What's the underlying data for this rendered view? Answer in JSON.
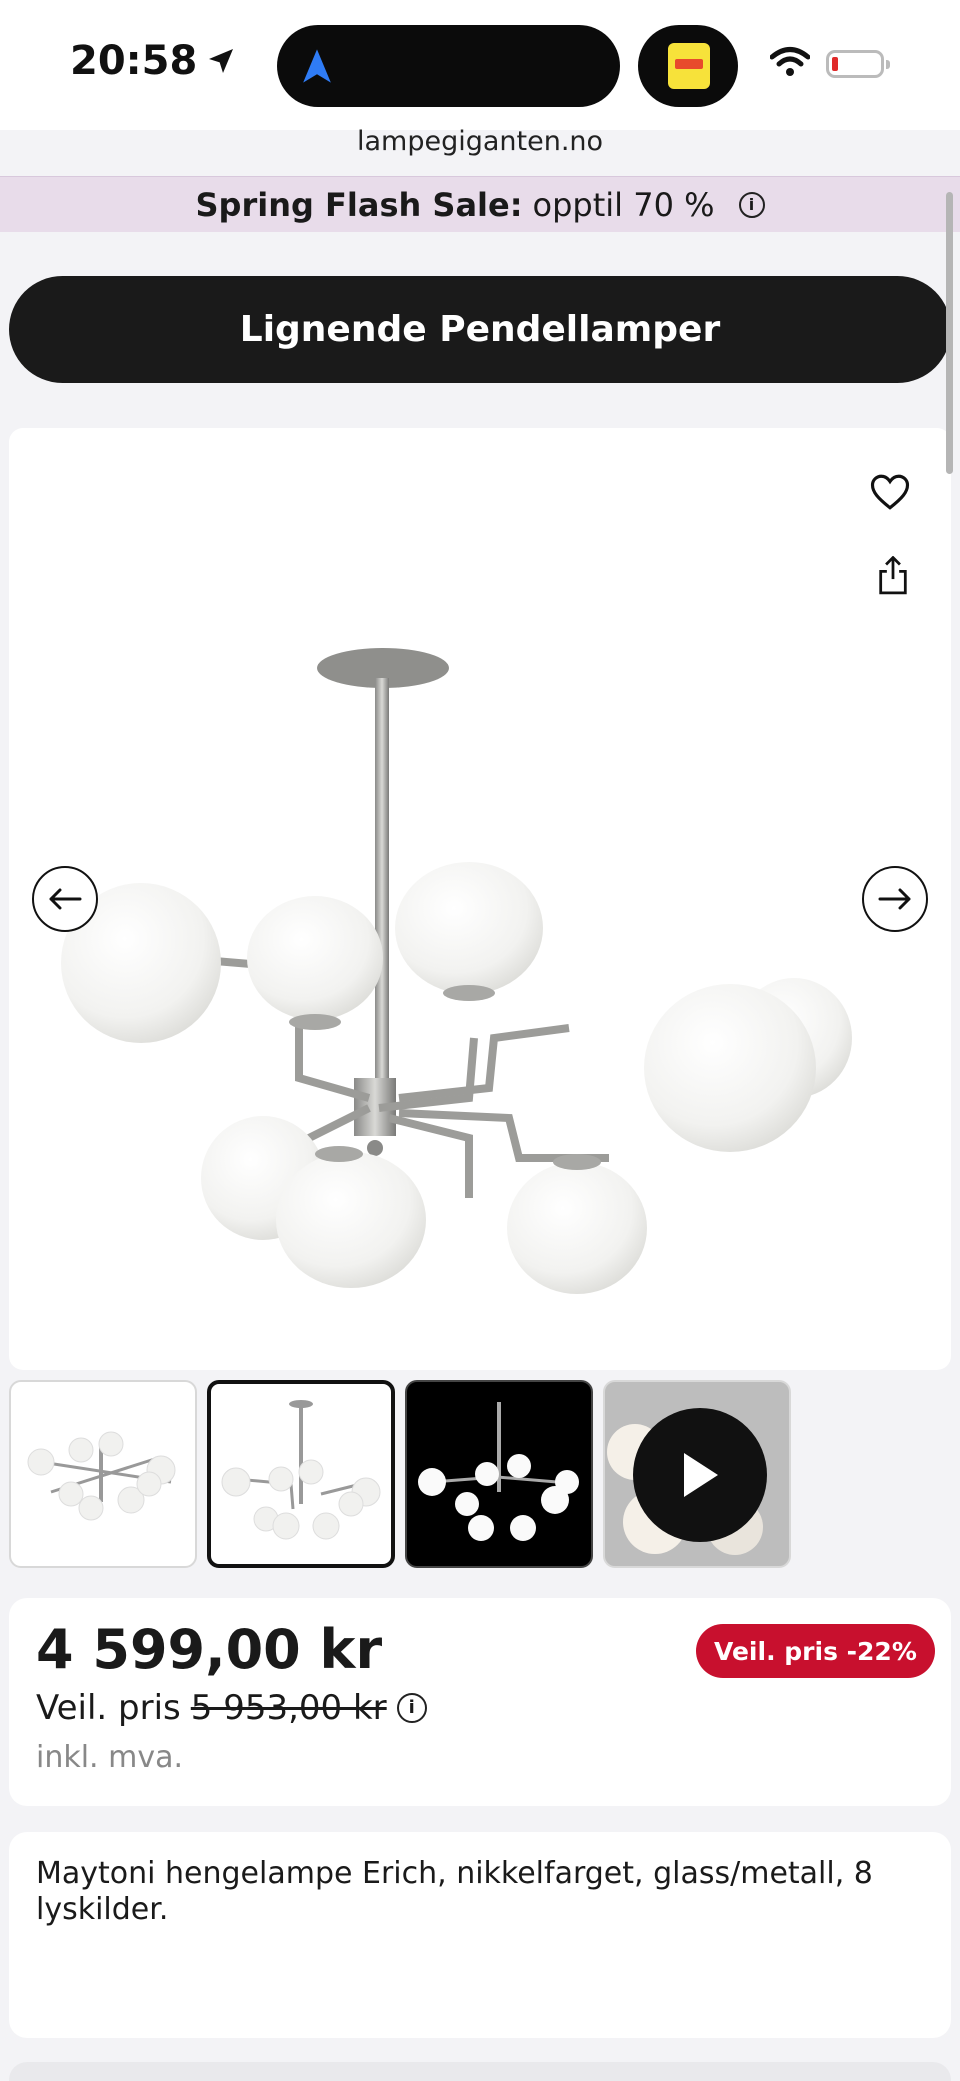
{
  "status_bar": {
    "time": "20:58",
    "url": "lampegiganten.no"
  },
  "banner": {
    "bold": "Spring Flash Sale:",
    "text": "opptil 70 %",
    "info": "i"
  },
  "similar_button": "Lignende Pendellamper",
  "product": {
    "price": "4 599,00 kr",
    "discount_badge": "Veil. pris -22%",
    "rec_label": "Veil. pris",
    "rec_price": "5 953,00 kr",
    "info": "i",
    "vat": "inkl. mva.",
    "description": "Maytoni hengelampe Erich, nikkelfarget, glass/metall, 8 lyskilder."
  },
  "icons": {
    "favorite": "heart-icon",
    "share": "share-icon",
    "prev": "arrow-left-icon",
    "next": "arrow-right-icon",
    "play": "play-icon"
  },
  "colors": {
    "banner_bg": "#e8dcea",
    "badge": "#c8102e",
    "button": "#1a1a1a"
  }
}
